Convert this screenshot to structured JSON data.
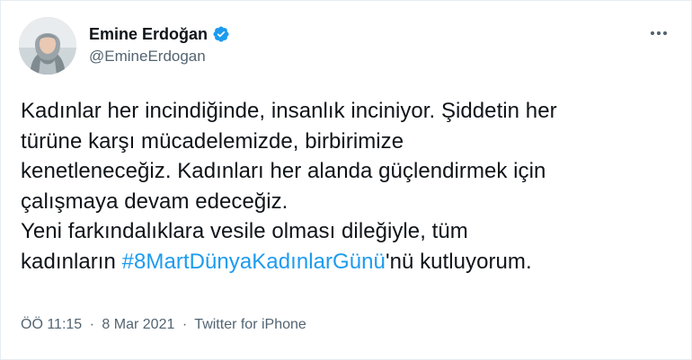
{
  "author": {
    "display_name": "Emine Erdoğan",
    "handle": "@EmineErdogan",
    "verified": true
  },
  "icons": {
    "verified": "verified-badge-icon",
    "more": "more-options-icon"
  },
  "colors": {
    "accent": "#1d9bf0",
    "text": "#0f1419",
    "muted": "#536471"
  },
  "tweet": {
    "lines": [
      "Kadınlar her incindiğinde, insanlık inciniyor. Şiddetin her",
      "türüne karşı mücadelemizde, birbirimize",
      "kenetleneceğiz. Kadınları her alanda güçlendirmek için",
      "çalışmaya devam edeceğiz.",
      "Yeni farkındalıklara vesile olması dileğiyle, tüm"
    ],
    "last_line_prefix": "kadınların ",
    "hashtag": "#8MartDünyaKadınlarGünü",
    "last_line_suffix": "'nü kutluyorum."
  },
  "meta": {
    "time": "ÖÖ 11:15",
    "date": "8 Mar 2021",
    "source": "Twitter for iPhone",
    "separator": "·"
  }
}
